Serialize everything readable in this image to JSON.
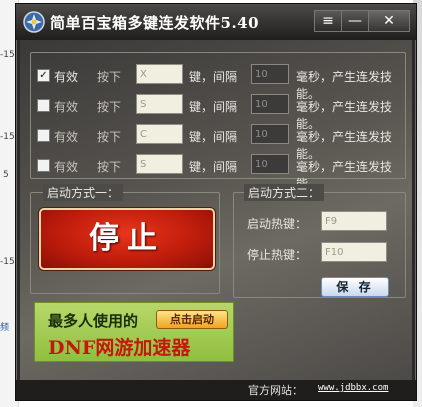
{
  "background": {
    "fragments": [
      "-15",
      "-15",
      "5",
      "-15",
      "频"
    ]
  },
  "window": {
    "title": "简单百宝箱多键连发软件5.40",
    "icon": "app-logo-icon",
    "controls": {
      "menu": "≡",
      "minimize": "—",
      "close": "✕"
    }
  },
  "rows": [
    {
      "checked": true,
      "check_mark": "✓",
      "enabled_label": "有效",
      "press_label": "按下",
      "key": "X",
      "sep_label": "键，间隔",
      "interval": "10",
      "suffix": "毫秒，产生连发技能。"
    },
    {
      "checked": false,
      "check_mark": "",
      "enabled_label": "有效",
      "press_label": "按下",
      "key": "S",
      "sep_label": "键，间隔",
      "interval": "10",
      "suffix": "毫秒，产生连发技能。"
    },
    {
      "checked": false,
      "check_mark": "",
      "enabled_label": "有效",
      "press_label": "按下",
      "key": "C",
      "sep_label": "键，间隔",
      "interval": "10",
      "suffix": "毫秒，产生连发技能。"
    },
    {
      "checked": false,
      "check_mark": "",
      "enabled_label": "有效",
      "press_label": "按下",
      "key": "S",
      "sep_label": "键，间隔",
      "interval": "10",
      "suffix": "毫秒，产生连发技能。"
    }
  ],
  "mode1": {
    "legend": "启动方式一：",
    "button": "停止"
  },
  "mode2": {
    "legend": "启动方式二：",
    "start_label": "启动热键：",
    "start_value": "F9",
    "stop_label": "停止热键：",
    "stop_value": "F10",
    "save": "保 存"
  },
  "ad": {
    "line1": "最多人使用的",
    "button": "点击启动",
    "line2": "DNF网游加速器"
  },
  "footer": {
    "label": "官方网站：",
    "link": "www.jdbbx.com"
  },
  "colors": {
    "window_bg": "#2b2a28",
    "stop_button": "#c01d0c",
    "ad_bg": "#8fbf3e",
    "ad_text_red": "#c5170c"
  }
}
